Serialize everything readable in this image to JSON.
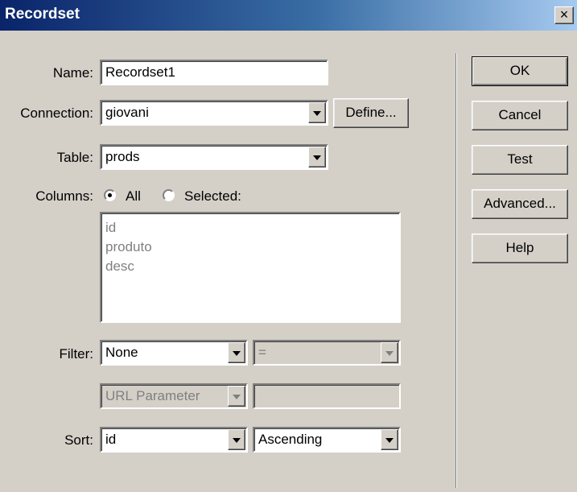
{
  "window": {
    "title": "Recordset",
    "close_glyph": "×"
  },
  "form": {
    "name_label": "Name:",
    "name_value": "Recordset1",
    "connection_label": "Connection:",
    "connection_value": "giovani",
    "define_button": "Define...",
    "table_label": "Table:",
    "table_value": "prods",
    "columns_label": "Columns:",
    "columns_all": "All",
    "columns_selected": "Selected:",
    "columns_mode": "All",
    "column_list": [
      "id",
      "produto",
      "desc"
    ],
    "filter_label": "Filter:",
    "filter_value": "None",
    "filter_operator": "=",
    "filter_source": "URL Parameter",
    "filter_source_value": "",
    "sort_label": "Sort:",
    "sort_value": "id",
    "sort_order": "Ascending"
  },
  "buttons": {
    "ok": "OK",
    "cancel": "Cancel",
    "test": "Test",
    "advanced": "Advanced...",
    "help": "Help"
  },
  "icons": {
    "dropdown": "chevron-down-icon",
    "close": "close-icon",
    "radio": "radio-icon"
  }
}
